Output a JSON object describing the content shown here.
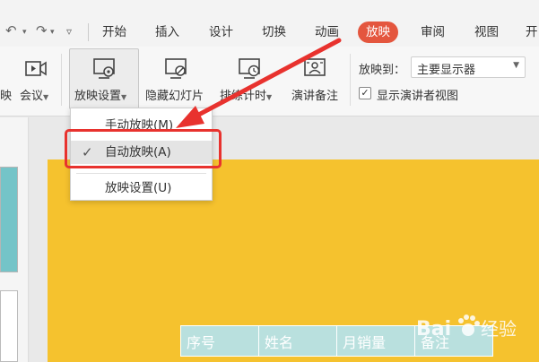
{
  "quick_access": {
    "undo_icon": "undo-icon",
    "redo_icon": "redo-icon",
    "more_icon": "more-icon"
  },
  "tabs": [
    {
      "label": "开始",
      "active": false
    },
    {
      "label": "插入",
      "active": false
    },
    {
      "label": "设计",
      "active": false
    },
    {
      "label": "切换",
      "active": false
    },
    {
      "label": "动画",
      "active": false
    },
    {
      "label": "放映",
      "active": true
    },
    {
      "label": "审阅",
      "active": false
    },
    {
      "label": "视图",
      "active": false
    },
    {
      "label": "开",
      "active": false
    }
  ],
  "ribbon": {
    "partial_label": "映",
    "meeting_label": "会议",
    "slideshow_settings_label": "放映设置",
    "hide_slide_label": "隐藏幻灯片",
    "rehearse_label": "排练计时",
    "speaker_notes_label": "演讲备注",
    "show_on_label": "放映到：",
    "show_on_value": "主要显示器",
    "presenter_view_label": "显示演讲者视图",
    "presenter_view_checked": true
  },
  "dropdown": {
    "items": [
      {
        "label": "手动放映(M)",
        "checked": false
      },
      {
        "label": "自动放映(A)",
        "checked": true
      },
      {
        "label": "放映设置(U)",
        "checked": false
      }
    ]
  },
  "table": {
    "headers": [
      "序号",
      "姓名",
      "月销量",
      "备注"
    ]
  },
  "watermark": {
    "brand": "Bai",
    "suffix": "经验"
  },
  "colors": {
    "active_tab": "#e4563e",
    "slide_background": "#f5c22e",
    "table_header": "#b9e0de",
    "annotation": "#e8322e",
    "thumbnail": "#74c4c8"
  }
}
